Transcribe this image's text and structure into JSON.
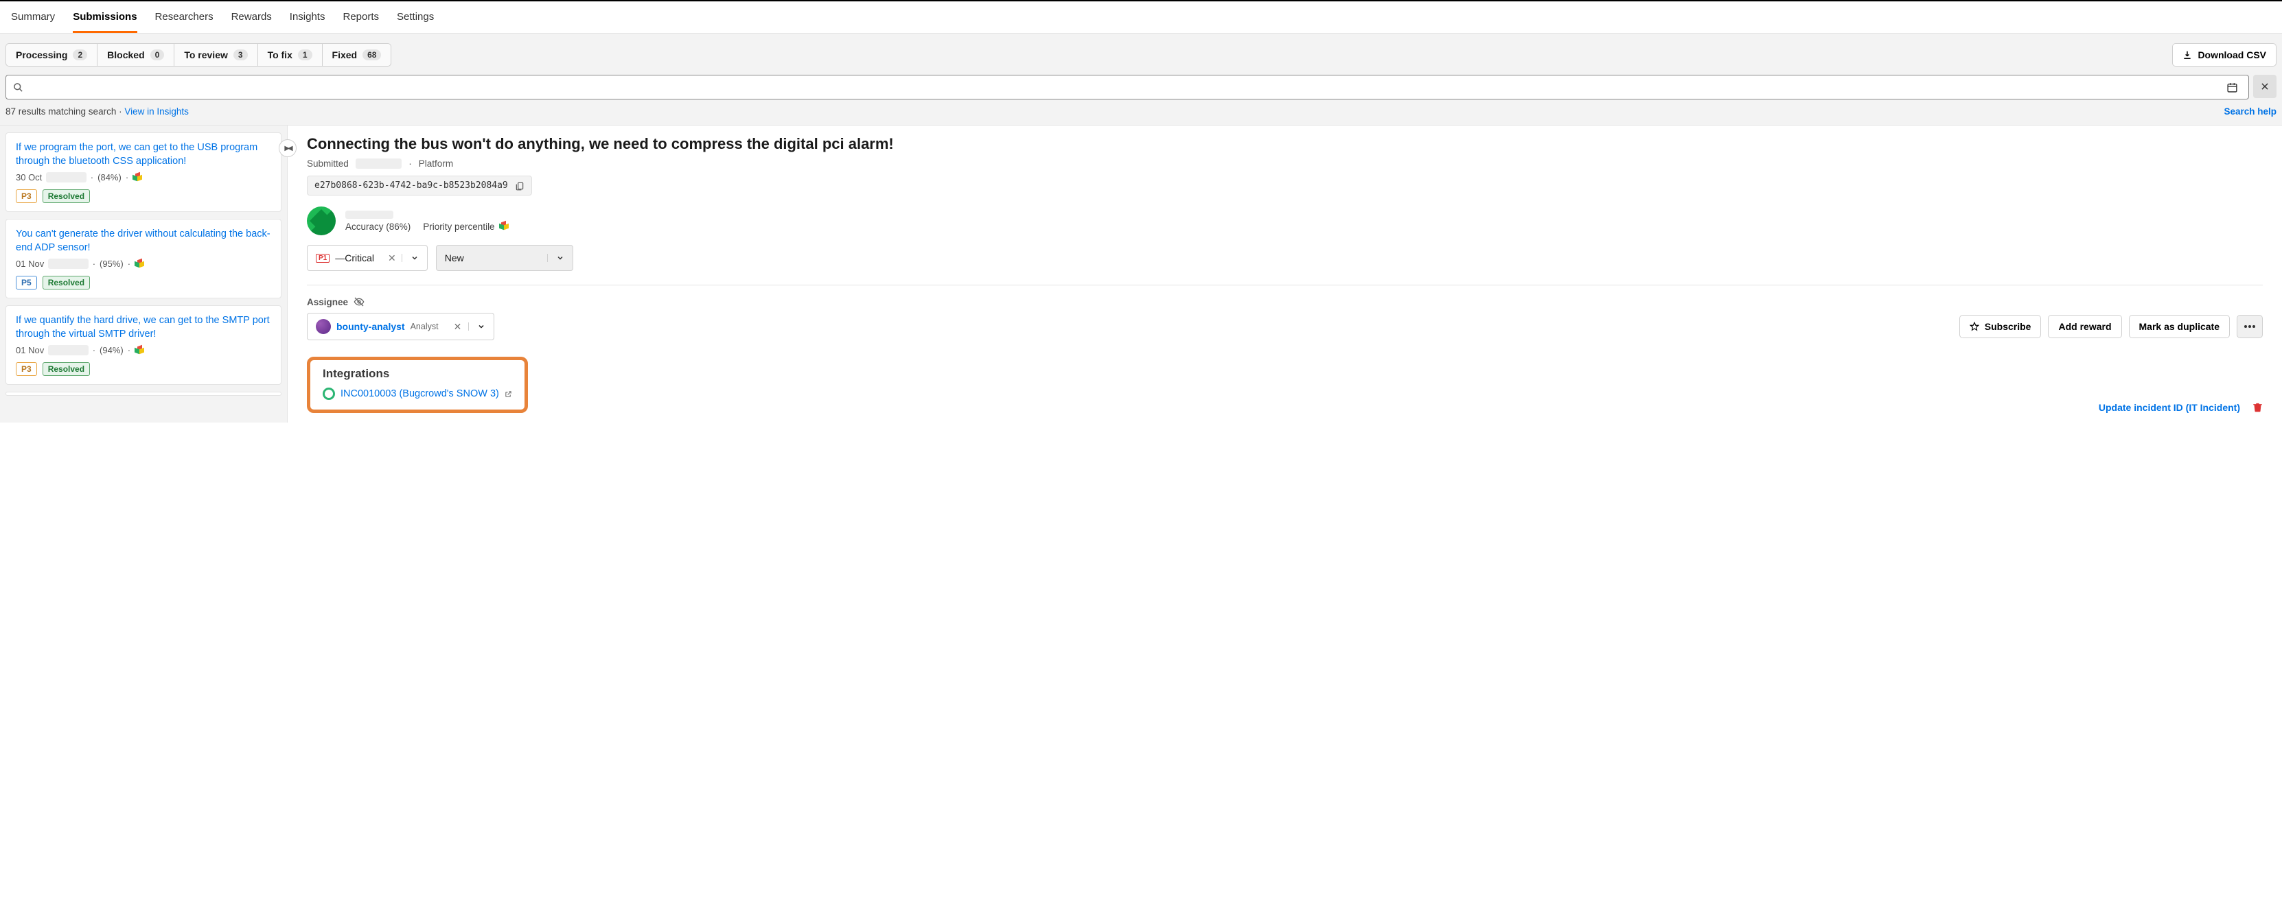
{
  "nav": {
    "tabs": [
      "Summary",
      "Submissions",
      "Researchers",
      "Rewards",
      "Insights",
      "Reports",
      "Settings"
    ],
    "active_index": 1
  },
  "filters": {
    "pills": [
      {
        "label": "Processing",
        "count": "2"
      },
      {
        "label": "Blocked",
        "count": "0"
      },
      {
        "label": "To review",
        "count": "3"
      },
      {
        "label": "To fix",
        "count": "1"
      },
      {
        "label": "Fixed",
        "count": "68"
      }
    ],
    "download_label": "Download CSV"
  },
  "search": {
    "results_text": "87 results matching search",
    "view_in_insights": "View in Insights",
    "search_help": "Search help"
  },
  "list": [
    {
      "title": "If we program the port, we can get to the USB program through the bluetooth CSS application!",
      "date": "30 Oct",
      "accuracy": "(84%)",
      "priority": "P3",
      "status": "Resolved"
    },
    {
      "title": "You can't generate the driver without calculating the back-end ADP sensor!",
      "date": "01 Nov",
      "accuracy": "(95%)",
      "priority": "P5",
      "status": "Resolved"
    },
    {
      "title": "If we quantify the hard drive, we can get to the SMTP port through the virtual SMTP driver!",
      "date": "01 Nov",
      "accuracy": "(94%)",
      "priority": "P3",
      "status": "Resolved"
    }
  ],
  "detail": {
    "title": "Connecting the bus won't do anything, we need to compress the digital pci alarm!",
    "submitted_label": "Submitted",
    "platform_label": "Platform",
    "uuid": "e27b0868-623b-4742-ba9c-b8523b2084a9",
    "reporter": {
      "accuracy": "Accuracy (86%)",
      "priority_percentile": "Priority percentile"
    },
    "priority_select": {
      "tag": "P1",
      "text": "—Critical"
    },
    "state_select": "New",
    "assignee": {
      "label": "Assignee",
      "name": "bounty-analyst",
      "role": "Analyst"
    },
    "actions": {
      "subscribe": "Subscribe",
      "add_reward": "Add reward",
      "mark_duplicate": "Mark as duplicate"
    },
    "integrations": {
      "heading": "Integrations",
      "link_text": "INC0010003 (Bugcrowd's SNOW 3)",
      "update_label": "Update incident ID (IT Incident)"
    }
  }
}
